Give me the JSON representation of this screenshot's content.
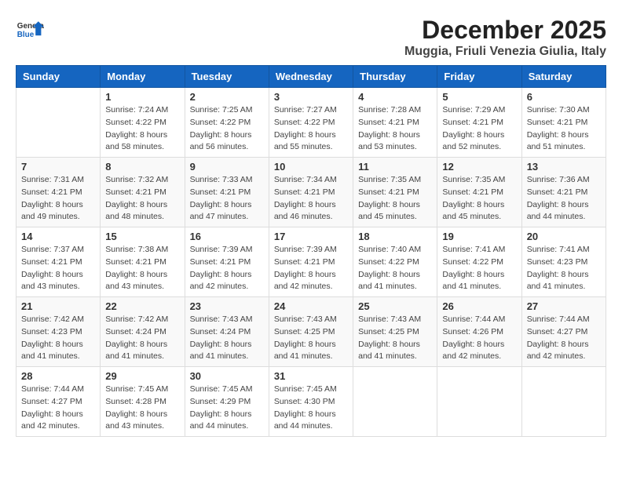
{
  "header": {
    "logo_general": "General",
    "logo_blue": "Blue",
    "month_title": "December 2025",
    "location": "Muggia, Friuli Venezia Giulia, Italy"
  },
  "days_of_week": [
    "Sunday",
    "Monday",
    "Tuesday",
    "Wednesday",
    "Thursday",
    "Friday",
    "Saturday"
  ],
  "weeks": [
    [
      {
        "day": "",
        "sunrise": "",
        "sunset": "",
        "daylight": ""
      },
      {
        "day": "1",
        "sunrise": "7:24 AM",
        "sunset": "4:22 PM",
        "daylight": "8 hours and 58 minutes."
      },
      {
        "day": "2",
        "sunrise": "7:25 AM",
        "sunset": "4:22 PM",
        "daylight": "8 hours and 56 minutes."
      },
      {
        "day": "3",
        "sunrise": "7:27 AM",
        "sunset": "4:22 PM",
        "daylight": "8 hours and 55 minutes."
      },
      {
        "day": "4",
        "sunrise": "7:28 AM",
        "sunset": "4:21 PM",
        "daylight": "8 hours and 53 minutes."
      },
      {
        "day": "5",
        "sunrise": "7:29 AM",
        "sunset": "4:21 PM",
        "daylight": "8 hours and 52 minutes."
      },
      {
        "day": "6",
        "sunrise": "7:30 AM",
        "sunset": "4:21 PM",
        "daylight": "8 hours and 51 minutes."
      }
    ],
    [
      {
        "day": "7",
        "sunrise": "7:31 AM",
        "sunset": "4:21 PM",
        "daylight": "8 hours and 49 minutes."
      },
      {
        "day": "8",
        "sunrise": "7:32 AM",
        "sunset": "4:21 PM",
        "daylight": "8 hours and 48 minutes."
      },
      {
        "day": "9",
        "sunrise": "7:33 AM",
        "sunset": "4:21 PM",
        "daylight": "8 hours and 47 minutes."
      },
      {
        "day": "10",
        "sunrise": "7:34 AM",
        "sunset": "4:21 PM",
        "daylight": "8 hours and 46 minutes."
      },
      {
        "day": "11",
        "sunrise": "7:35 AM",
        "sunset": "4:21 PM",
        "daylight": "8 hours and 45 minutes."
      },
      {
        "day": "12",
        "sunrise": "7:35 AM",
        "sunset": "4:21 PM",
        "daylight": "8 hours and 45 minutes."
      },
      {
        "day": "13",
        "sunrise": "7:36 AM",
        "sunset": "4:21 PM",
        "daylight": "8 hours and 44 minutes."
      }
    ],
    [
      {
        "day": "14",
        "sunrise": "7:37 AM",
        "sunset": "4:21 PM",
        "daylight": "8 hours and 43 minutes."
      },
      {
        "day": "15",
        "sunrise": "7:38 AM",
        "sunset": "4:21 PM",
        "daylight": "8 hours and 43 minutes."
      },
      {
        "day": "16",
        "sunrise": "7:39 AM",
        "sunset": "4:21 PM",
        "daylight": "8 hours and 42 minutes."
      },
      {
        "day": "17",
        "sunrise": "7:39 AM",
        "sunset": "4:21 PM",
        "daylight": "8 hours and 42 minutes."
      },
      {
        "day": "18",
        "sunrise": "7:40 AM",
        "sunset": "4:22 PM",
        "daylight": "8 hours and 41 minutes."
      },
      {
        "day": "19",
        "sunrise": "7:41 AM",
        "sunset": "4:22 PM",
        "daylight": "8 hours and 41 minutes."
      },
      {
        "day": "20",
        "sunrise": "7:41 AM",
        "sunset": "4:23 PM",
        "daylight": "8 hours and 41 minutes."
      }
    ],
    [
      {
        "day": "21",
        "sunrise": "7:42 AM",
        "sunset": "4:23 PM",
        "daylight": "8 hours and 41 minutes."
      },
      {
        "day": "22",
        "sunrise": "7:42 AM",
        "sunset": "4:24 PM",
        "daylight": "8 hours and 41 minutes."
      },
      {
        "day": "23",
        "sunrise": "7:43 AM",
        "sunset": "4:24 PM",
        "daylight": "8 hours and 41 minutes."
      },
      {
        "day": "24",
        "sunrise": "7:43 AM",
        "sunset": "4:25 PM",
        "daylight": "8 hours and 41 minutes."
      },
      {
        "day": "25",
        "sunrise": "7:43 AM",
        "sunset": "4:25 PM",
        "daylight": "8 hours and 41 minutes."
      },
      {
        "day": "26",
        "sunrise": "7:44 AM",
        "sunset": "4:26 PM",
        "daylight": "8 hours and 42 minutes."
      },
      {
        "day": "27",
        "sunrise": "7:44 AM",
        "sunset": "4:27 PM",
        "daylight": "8 hours and 42 minutes."
      }
    ],
    [
      {
        "day": "28",
        "sunrise": "7:44 AM",
        "sunset": "4:27 PM",
        "daylight": "8 hours and 42 minutes."
      },
      {
        "day": "29",
        "sunrise": "7:45 AM",
        "sunset": "4:28 PM",
        "daylight": "8 hours and 43 minutes."
      },
      {
        "day": "30",
        "sunrise": "7:45 AM",
        "sunset": "4:29 PM",
        "daylight": "8 hours and 44 minutes."
      },
      {
        "day": "31",
        "sunrise": "7:45 AM",
        "sunset": "4:30 PM",
        "daylight": "8 hours and 44 minutes."
      },
      {
        "day": "",
        "sunrise": "",
        "sunset": "",
        "daylight": ""
      },
      {
        "day": "",
        "sunrise": "",
        "sunset": "",
        "daylight": ""
      },
      {
        "day": "",
        "sunrise": "",
        "sunset": "",
        "daylight": ""
      }
    ]
  ],
  "labels": {
    "sunrise": "Sunrise:",
    "sunset": "Sunset:",
    "daylight": "Daylight:"
  }
}
